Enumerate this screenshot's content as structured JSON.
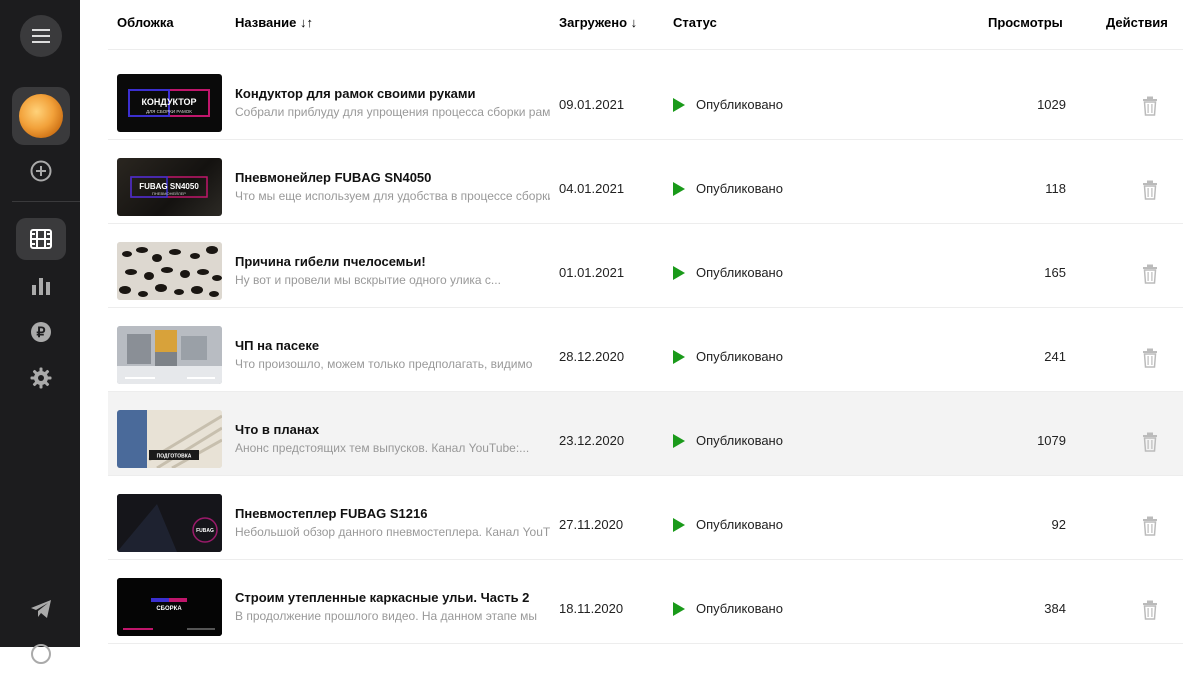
{
  "sidebar": {
    "icons": [
      "menu-icon",
      "channel-avatar",
      "add-icon",
      "videos-icon",
      "stats-icon",
      "ruble-icon",
      "gear-icon",
      "telegram-icon"
    ]
  },
  "table": {
    "headers": {
      "cover": "Обложка",
      "title": "Название ↓↑",
      "uploaded": "Загружено ↓",
      "status": "Статус",
      "views": "Просмотры",
      "actions": "Действия"
    },
    "rows": [
      {
        "title": "Кондуктор для рамок своими руками",
        "description": "Собрали приблуду для упрощения процесса сборки рамок",
        "date": "09.01.2021",
        "status": "Опубликовано",
        "views": "1029",
        "highlighted": false
      },
      {
        "title": "Пневмонейлер FUBAG SN4050",
        "description": "Что мы еще используем для удобства в процессе сборки ульев",
        "date": "04.01.2021",
        "status": "Опубликовано",
        "views": "118",
        "highlighted": false
      },
      {
        "title": "Причина гибели пчелосемьи!",
        "description": "Ну вот и провели мы вскрытие одного улика с...",
        "date": "01.01.2021",
        "status": "Опубликовано",
        "views": "165",
        "highlighted": false
      },
      {
        "title": "ЧП на пасеке",
        "description": "Что произошло, можем только предполагать, видимо",
        "date": "28.12.2020",
        "status": "Опубликовано",
        "views": "241",
        "highlighted": false
      },
      {
        "title": "Что в планах",
        "description": "Анонс предстоящих тем выпусков. Канал YouTube:...",
        "date": "23.12.2020",
        "status": "Опубликовано",
        "views": "1079",
        "highlighted": true
      },
      {
        "title": "Пневмостеплер FUBAG S1216",
        "description": "Небольшой обзор данного пневмостеплера. Канал YouTube",
        "date": "27.11.2020",
        "status": "Опубликовано",
        "views": "92",
        "highlighted": false
      },
      {
        "title": "Строим утепленные каркасные ульи. Часть 2",
        "description": "В продолжение прошлого видео. На данном этапе мы",
        "date": "18.11.2020",
        "status": "Опубликовано",
        "views": "384",
        "highlighted": false
      }
    ],
    "thumbnails": [
      {
        "text": "КОНДУКТОР",
        "sub": "ДЛЯ СБОРКИ РАМОК"
      },
      {
        "text": "FUBAG SN4050",
        "sub": "ПНЕВМОНЕЙЛЕР"
      },
      {
        "text": "",
        "sub": ""
      },
      {
        "text": "",
        "sub": ""
      },
      {
        "text": "ПОДГОТОВКА",
        "sub": ""
      },
      {
        "text": "FUBAG",
        "sub": ""
      },
      {
        "text": "СБОРКА",
        "sub": ""
      }
    ],
    "status_color": "#1a9a1a"
  }
}
